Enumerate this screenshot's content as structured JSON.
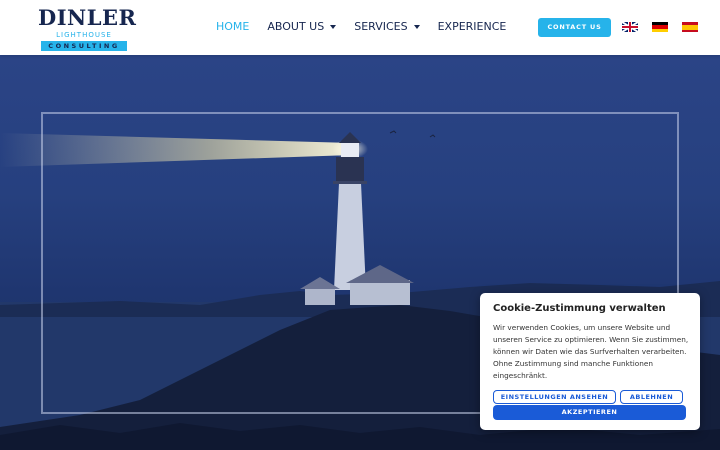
{
  "header": {
    "logo": {
      "name": "DINLER",
      "sub": "LIGHTHOUSE",
      "tag": "CONSULTING"
    },
    "nav": [
      {
        "label": "HOME",
        "active": true,
        "dropdown": false
      },
      {
        "label": "ABOUT US",
        "active": false,
        "dropdown": true
      },
      {
        "label": "SERVICES",
        "active": false,
        "dropdown": true
      },
      {
        "label": "EXPERIENCE",
        "active": false,
        "dropdown": false
      }
    ],
    "contact_label": "CONTACT US",
    "languages": [
      "flag-uk-icon",
      "flag-de-icon",
      "flag-es-icon"
    ]
  },
  "hero": {
    "image": "lighthouse-at-night"
  },
  "cookie": {
    "title": "Cookie-Zustimmung verwalten",
    "text": "Wir verwenden Cookies, um unsere Website und unseren Service zu optimieren. Wenn Sie zustimmen, können wir Daten wie das Surfverhalten verarbeiten. Ohne Zustimmung sind manche Funktionen eingeschränkt.",
    "settings_label": "EINSTELLUNGEN ANSEHEN",
    "reject_label": "ABLEHNEN",
    "accept_label": "AKZEPTIEREN"
  },
  "colors": {
    "brand_navy": "#16264f",
    "accent_cyan": "#26b3ea",
    "button_blue": "#1a5bd7"
  }
}
